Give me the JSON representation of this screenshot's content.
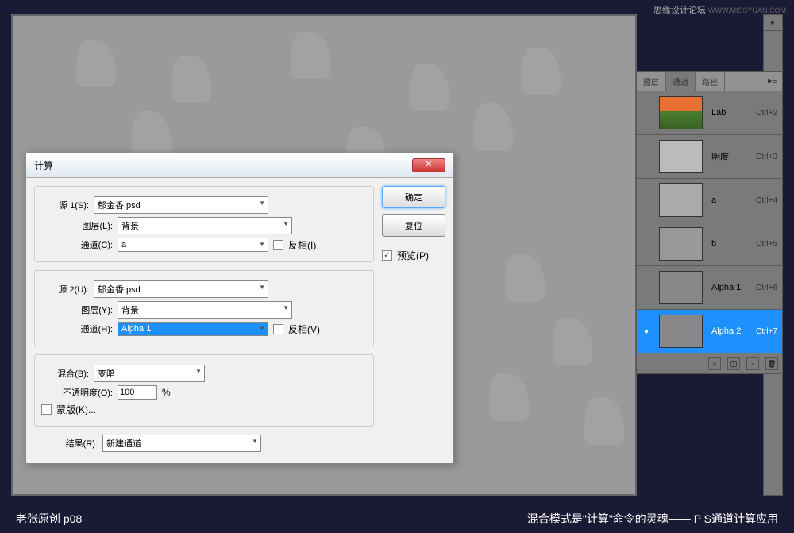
{
  "watermark": {
    "text1": "思缘设计论坛",
    "text2": "WWW.MISSYUAN.COM"
  },
  "dialog": {
    "title": "计算",
    "source1": {
      "label": "源 1(S):",
      "file": "郁金香.psd",
      "layer_label": "图层(L):",
      "layer": "背景",
      "channel_label": "通道(C):",
      "channel": "a",
      "invert_label": "反相(I)"
    },
    "source2": {
      "label": "源 2(U):",
      "file": "郁金香.psd",
      "layer_label": "图层(Y):",
      "layer": "背景",
      "channel_label": "通道(H):",
      "channel": "Alpha 1",
      "invert_label": "反相(V)"
    },
    "blend": {
      "label": "混合(B):",
      "mode": "变暗"
    },
    "opacity": {
      "label": "不透明度(O):",
      "value": "100",
      "unit": "%"
    },
    "mask": {
      "label": "蒙版(K)..."
    },
    "result": {
      "label": "结果(R):",
      "value": "新建通道"
    },
    "buttons": {
      "ok": "确定",
      "cancel": "复位",
      "preview": "预览(P)"
    }
  },
  "channels": {
    "tabs": {
      "layers": "图层",
      "channels": "通道",
      "paths": "路径"
    },
    "items": [
      {
        "name": "Lab",
        "shortcut": "Ctrl+2",
        "thumb": "color"
      },
      {
        "name": "明度",
        "shortcut": "Ctrl+3",
        "thumb": "gray1"
      },
      {
        "name": "a",
        "shortcut": "Ctrl+4",
        "thumb": "gray2"
      },
      {
        "name": "b",
        "shortcut": "Ctrl+5",
        "thumb": "gray3"
      },
      {
        "name": "Alpha 1",
        "shortcut": "Ctrl+6",
        "thumb": "gray4"
      },
      {
        "name": "Alpha 2",
        "shortcut": "Ctrl+7",
        "thumb": "gray4",
        "selected": true,
        "visible": true
      }
    ]
  },
  "footer": {
    "left": "老张原创    p08",
    "right": "混合模式是\"计算\"命令的灵魂—— P S通道计算应用"
  }
}
